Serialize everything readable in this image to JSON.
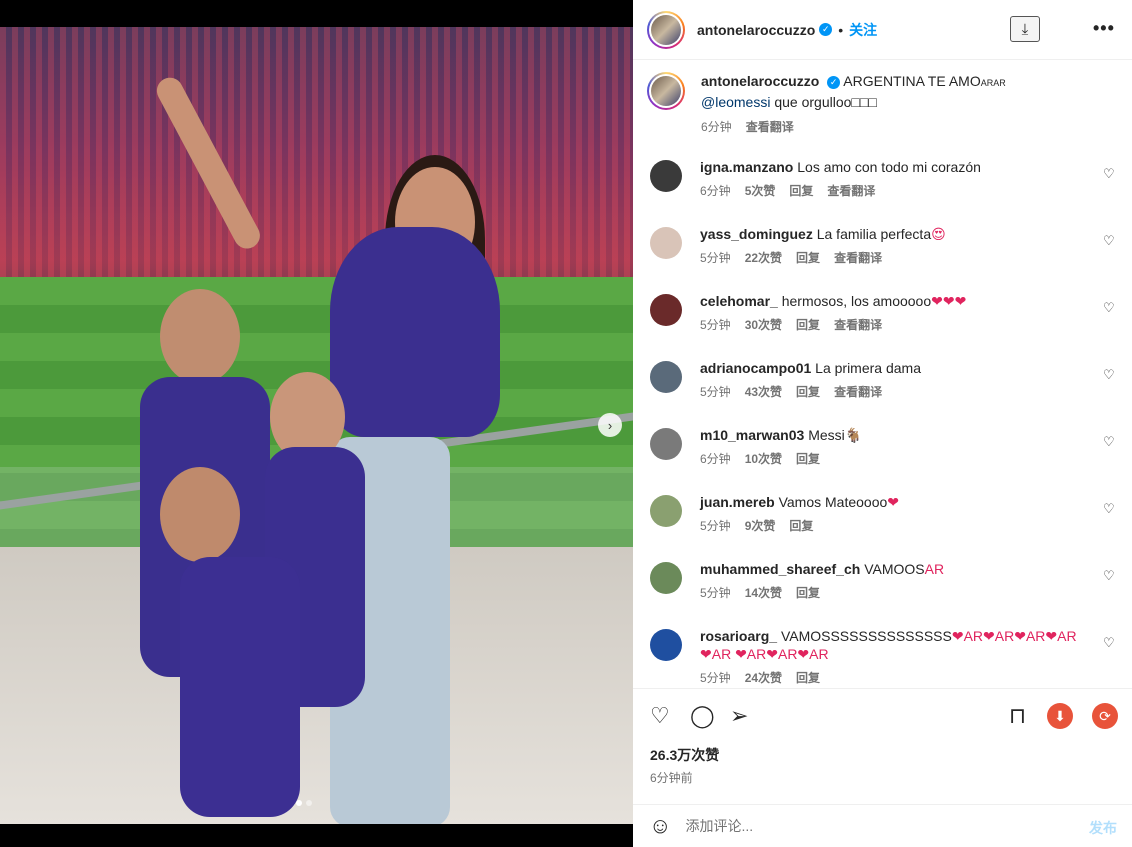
{
  "header": {
    "username": "antonelaroccuzzo",
    "separator": "•",
    "follow_label": "关注",
    "download_icon": "download-icon",
    "more_icon": "more-icon",
    "more_glyph": "•••"
  },
  "caption": {
    "username": "antonelaroccuzzo",
    "text": "ARGENTINA TE AMO",
    "flags": "ARAR",
    "mention": "@leomessi",
    "text2": "que orgulloo",
    "boxes": "□□□",
    "time": "6分钟",
    "translate": "查看翻译"
  },
  "comments": [
    {
      "user": "igna.manzano",
      "text": "Los amo con todo mi corazón",
      "emoji": "",
      "time": "6分钟",
      "likes": "5次赞",
      "reply": "回复",
      "translate": "查看翻译",
      "avatar_color": "#3a3a3a"
    },
    {
      "user": "yass_dominguez",
      "text": "La familia perfecta",
      "emoji": "😍",
      "time": "5分钟",
      "likes": "22次赞",
      "reply": "回复",
      "translate": "查看翻译",
      "avatar_color": "#d9c4b8"
    },
    {
      "user": "celehomar_",
      "text": "hermosos, los amooooo",
      "emoji": "❤❤❤",
      "time": "5分钟",
      "likes": "30次赞",
      "reply": "回复",
      "translate": "查看翻译",
      "avatar_color": "#6a2a2a"
    },
    {
      "user": "adrianocampo01",
      "text": "La primera dama",
      "emoji": "",
      "time": "5分钟",
      "likes": "43次赞",
      "reply": "回复",
      "translate": "查看翻译",
      "avatar_color": "#5a6a7a"
    },
    {
      "user": "m10_marwan03",
      "text": "Messi",
      "emoji": "🐐",
      "time": "6分钟",
      "likes": "10次赞",
      "reply": "回复",
      "translate": "",
      "avatar_color": "#7a7a7a"
    },
    {
      "user": "juan.mereb",
      "text": "Vamos Mateoooo",
      "emoji": "❤",
      "time": "5分钟",
      "likes": "9次赞",
      "reply": "回复",
      "translate": "",
      "avatar_color": "#8aa070"
    },
    {
      "user": "muhammed_shareef_ch",
      "text": "VAMOOS",
      "emoji": "AR",
      "time": "5分钟",
      "likes": "14次赞",
      "reply": "回复",
      "translate": "",
      "avatar_color": "#6b8a5a"
    },
    {
      "user": "rosarioarg_",
      "text": "VAMOSSSSSSSSSSSSSS",
      "emoji": "❤AR❤AR❤AR❤AR❤AR ❤AR❤AR❤AR",
      "time": "5分钟",
      "likes": "24次赞",
      "reply": "回复",
      "translate": "",
      "avatar_color": "#1f4fa0"
    }
  ],
  "actions": {
    "like_icon": "heart-icon",
    "comment_icon": "comment-icon",
    "share_icon": "share-icon",
    "save_icon": "bookmark-icon",
    "likes_count": "26.3万次赞",
    "posted_time": "6分钟前"
  },
  "add_comment": {
    "placeholder": "添加评论...",
    "post_label": "发布",
    "emoji_icon": "smile-icon"
  },
  "carousel": {
    "next_glyph": "›",
    "dots": 2,
    "active_dot": 0
  },
  "colors": {
    "accent": "#0095f6",
    "mention": "#00376b",
    "post_disabled": "#b2dffc",
    "download_red": "#e8533a"
  }
}
